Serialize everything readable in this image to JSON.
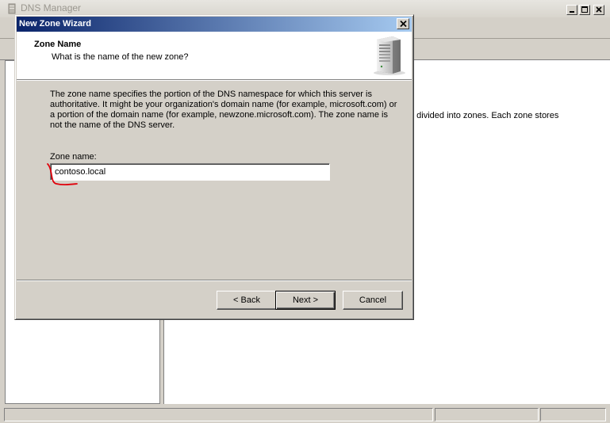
{
  "parent": {
    "title": "DNS Manager",
    "content_text": "e divided into zones. Each zone stores"
  },
  "wizard": {
    "title": "New Zone Wizard",
    "heading": "Zone Name",
    "subheading": "What is the name of the new zone?",
    "description": "The zone name specifies the portion of the DNS namespace for which this server is authoritative. It might be your organization's domain name (for example,  microsoft.com) or a portion of the domain name (for example, newzone.microsoft.com). The zone name is not the name of the DNS server.",
    "zone_name_label": "Zone name:",
    "zone_name_value": "contoso.local",
    "buttons": {
      "back": "< Back",
      "next": "Next >",
      "cancel": "Cancel"
    }
  },
  "icons": [
    "app-icon",
    "minimize-icon",
    "maximize-icon",
    "close-icon",
    "server-icon"
  ],
  "colors": {
    "title_gradient_start": "#0a246a",
    "title_gradient_end": "#a6caf0",
    "face": "#d4d0c8",
    "annotation_red": "#e0000b"
  }
}
